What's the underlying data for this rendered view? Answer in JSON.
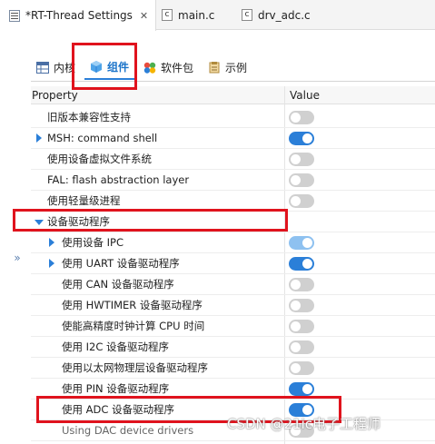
{
  "editor_tabs": [
    {
      "label": "*RT-Thread Settings",
      "icon": "settings-file-icon",
      "active": true
    },
    {
      "label": "main.c",
      "icon": "c-file-icon",
      "active": false
    },
    {
      "label": "drv_adc.c",
      "icon": "c-file-icon",
      "active": false
    }
  ],
  "close_glyph": "✕",
  "c_glyph": "c",
  "subtabs": [
    {
      "label": "内核",
      "icon": "kernel-icon",
      "selected": false
    },
    {
      "label": "组件",
      "icon": "component-cube-icon",
      "selected": true
    },
    {
      "label": "软件包",
      "icon": "package-icon",
      "selected": false
    },
    {
      "label": "示例",
      "icon": "example-icon",
      "selected": false
    }
  ],
  "table": {
    "header_property": "Property",
    "header_value": "Value",
    "rows": [
      {
        "label": "旧版本兼容性支持",
        "expand": "none",
        "indent": 0,
        "toggle": "off"
      },
      {
        "label": "MSH: command shell",
        "expand": "collapsed",
        "indent": 0,
        "toggle": "on"
      },
      {
        "label": "使用设备虚拟文件系统",
        "expand": "none",
        "indent": 0,
        "toggle": "off"
      },
      {
        "label": "FAL: flash abstraction layer",
        "expand": "none",
        "indent": 0,
        "toggle": "off"
      },
      {
        "label": "使用轻量级进程",
        "expand": "none",
        "indent": 0,
        "toggle": "off"
      },
      {
        "label": "设备驱动程序",
        "expand": "expanded",
        "indent": 0,
        "toggle": "none"
      },
      {
        "label": "使用设备 IPC",
        "expand": "collapsed",
        "indent": 1,
        "toggle": "light"
      },
      {
        "label": "使用 UART 设备驱动程序",
        "expand": "collapsed",
        "indent": 1,
        "toggle": "on"
      },
      {
        "label": "使用 CAN 设备驱动程序",
        "expand": "none",
        "indent": 1,
        "toggle": "off"
      },
      {
        "label": "使用 HWTIMER 设备驱动程序",
        "expand": "none",
        "indent": 1,
        "toggle": "off"
      },
      {
        "label": "使能高精度时钟计算 CPU 时间",
        "expand": "none",
        "indent": 1,
        "toggle": "off"
      },
      {
        "label": "使用 I2C 设备驱动程序",
        "expand": "none",
        "indent": 1,
        "toggle": "off"
      },
      {
        "label": "使用以太网物理层设备驱动程序",
        "expand": "none",
        "indent": 1,
        "toggle": "off"
      },
      {
        "label": "使用 PIN 设备驱动程序",
        "expand": "none",
        "indent": 1,
        "toggle": "on"
      },
      {
        "label": "使用 ADC 设备驱动程序",
        "expand": "none",
        "indent": 1,
        "toggle": "on"
      },
      {
        "label": "Using DAC device drivers",
        "expand": "none",
        "indent": 1,
        "toggle": "off"
      }
    ]
  },
  "sidebar_expand_glyph": "»",
  "watermark": "CSDN @21ic电子工程师",
  "colors": {
    "accent": "#2b7fd8",
    "toggle_off": "#d0d0d0",
    "highlight_border": "#e0131d"
  }
}
